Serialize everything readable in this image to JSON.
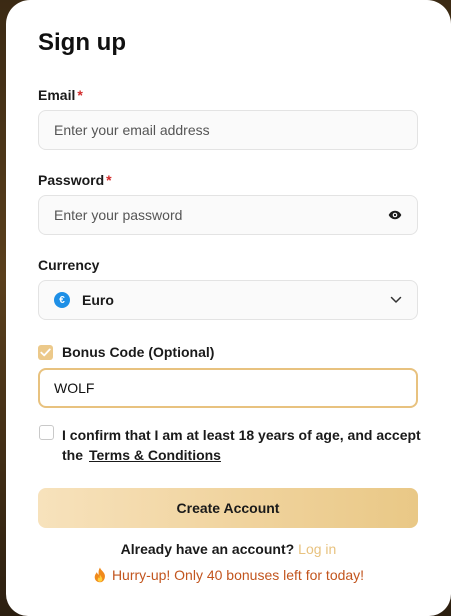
{
  "form": {
    "title": "Sign up",
    "email": {
      "label": "Email",
      "required_mark": "*",
      "placeholder": "Enter your email address",
      "value": ""
    },
    "password": {
      "label": "Password",
      "required_mark": "*",
      "placeholder": "Enter your password",
      "value": "",
      "toggle_icon": "eye-icon"
    },
    "currency": {
      "label": "Currency",
      "selected": "Euro",
      "symbol": "€",
      "symbol_color": "#1e8fe6",
      "dropdown_icon": "chevron-down-icon"
    },
    "bonus": {
      "checked": true,
      "label": "Bonus Code (Optional)",
      "value": "WOLF"
    },
    "age_confirm": {
      "checked": false,
      "text": "I confirm that I am at least 18 years of age, and accept the",
      "link_text": "Terms & Conditions"
    },
    "submit_label": "Create Account",
    "login_prompt": "Already have an account?",
    "login_link": "Log in",
    "promo_text": "Hurry-up! Only 40 bonuses left for today!",
    "promo_icon": "fire-icon"
  },
  "colors": {
    "accent": "#e8c27f",
    "required": "#d12a2a",
    "promo": "#c2551e"
  }
}
